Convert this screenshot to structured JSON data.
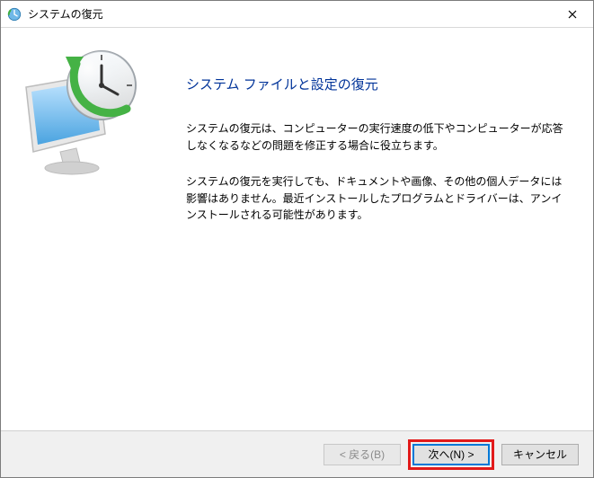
{
  "titlebar": {
    "title": "システムの復元",
    "program_icon": "system-restore-icon",
    "close_icon": "close-icon"
  },
  "content": {
    "heading": "システム ファイルと設定の復元",
    "paragraph1": "システムの復元は、コンピューターの実行速度の低下やコンピューターが応答しなくなるなどの問題を修正する場合に役立ちます。",
    "paragraph2": "システムの復元を実行しても、ドキュメントや画像、その他の個人データには影響はありません。最近インストールしたプログラムとドライバーは、アンインストールされる可能性があります。"
  },
  "illustration": {
    "name": "system-restore-illustration"
  },
  "footer": {
    "back_label": "< 戻る(B)",
    "next_label": "次へ(N) >",
    "cancel_label": "キャンセル"
  }
}
